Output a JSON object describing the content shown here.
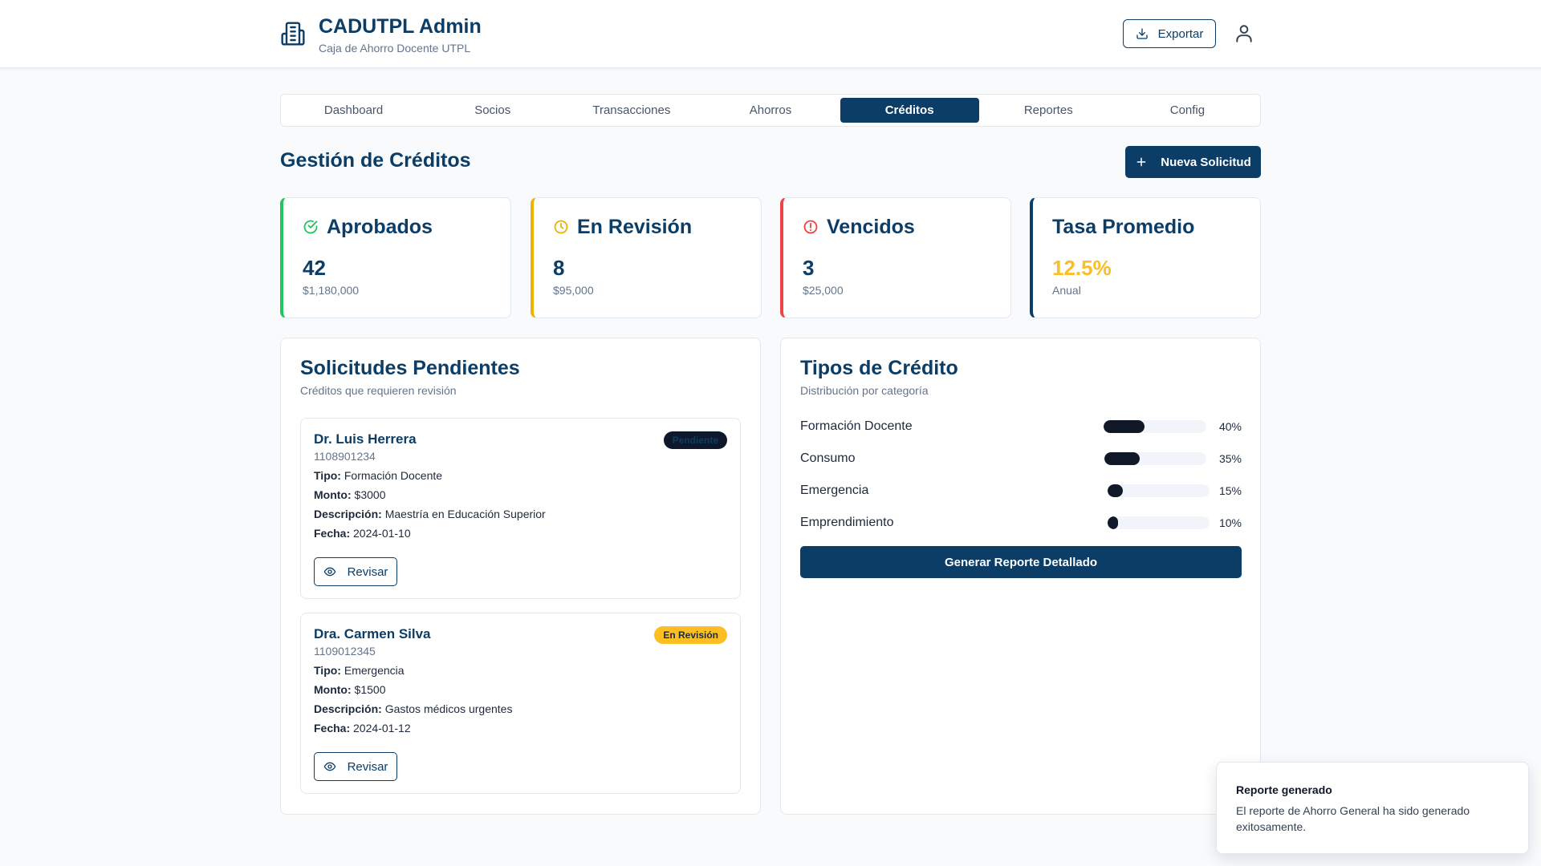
{
  "header": {
    "title": "CADUTPL Admin",
    "subtitle": "Caja de Ahorro Docente UTPL",
    "export_label": "Exportar"
  },
  "tabs": [
    {
      "label": "Dashboard",
      "active": false
    },
    {
      "label": "Socios",
      "active": false
    },
    {
      "label": "Transacciones",
      "active": false
    },
    {
      "label": "Ahorros",
      "active": false
    },
    {
      "label": "Créditos",
      "active": true
    },
    {
      "label": "Reportes",
      "active": false
    },
    {
      "label": "Config",
      "active": false
    }
  ],
  "page": {
    "title": "Gestión de Créditos",
    "new_button_label": "Nueva Solicitud"
  },
  "stats": [
    {
      "title": "Aprobados",
      "value": "42",
      "sub": "$1,180,000",
      "accent": "#22c55e",
      "icon": "check-circle-icon"
    },
    {
      "title": "En Revisión",
      "value": "8",
      "sub": "$95,000",
      "accent": "#eab308",
      "icon": "clock-icon"
    },
    {
      "title": "Vencidos",
      "value": "3",
      "sub": "$25,000",
      "accent": "#ef4444",
      "icon": "alert-circle-icon"
    },
    {
      "title": "Tasa Promedio",
      "value": "12.5%",
      "sub": "Anual",
      "accent": "#0b3d66",
      "value_color": "#fbbf24"
    }
  ],
  "pending": {
    "title": "Solicitudes Pendientes",
    "subtitle": "Créditos que requieren revisión",
    "field_labels": {
      "tipo": "Tipo:",
      "monto": "Monto:",
      "descripcion": "Descripción:",
      "fecha": "Fecha:"
    },
    "review_label": "Revisar",
    "items": [
      {
        "name": "Dr. Luis Herrera",
        "id": "1108901234",
        "badge": "Pendiente",
        "tipo": "Formación Docente",
        "monto": "$3000",
        "descripcion": "Maestría en Educación Superior",
        "fecha": "2024-01-10"
      },
      {
        "name": "Dra. Carmen Silva",
        "id": "1109012345",
        "badge": "En Revisión",
        "tipo": "Emergencia",
        "monto": "$1500",
        "descripcion": "Gastos médicos urgentes",
        "fecha": "2024-01-12"
      }
    ]
  },
  "types": {
    "title": "Tipos de Crédito",
    "subtitle": "Distribución por categoría",
    "items": [
      {
        "label": "Formación Docente",
        "percent": 40,
        "display": "40%"
      },
      {
        "label": "Consumo",
        "percent": 35,
        "display": "35%"
      },
      {
        "label": "Emergencia",
        "percent": 15,
        "display": "15%"
      },
      {
        "label": "Emprendimiento",
        "percent": 10,
        "display": "10%"
      }
    ],
    "button_label": "Generar Reporte Detallado"
  },
  "toast": {
    "title": "Reporte generado",
    "message": "El reporte de Ahorro General ha sido generado exitosamente."
  }
}
